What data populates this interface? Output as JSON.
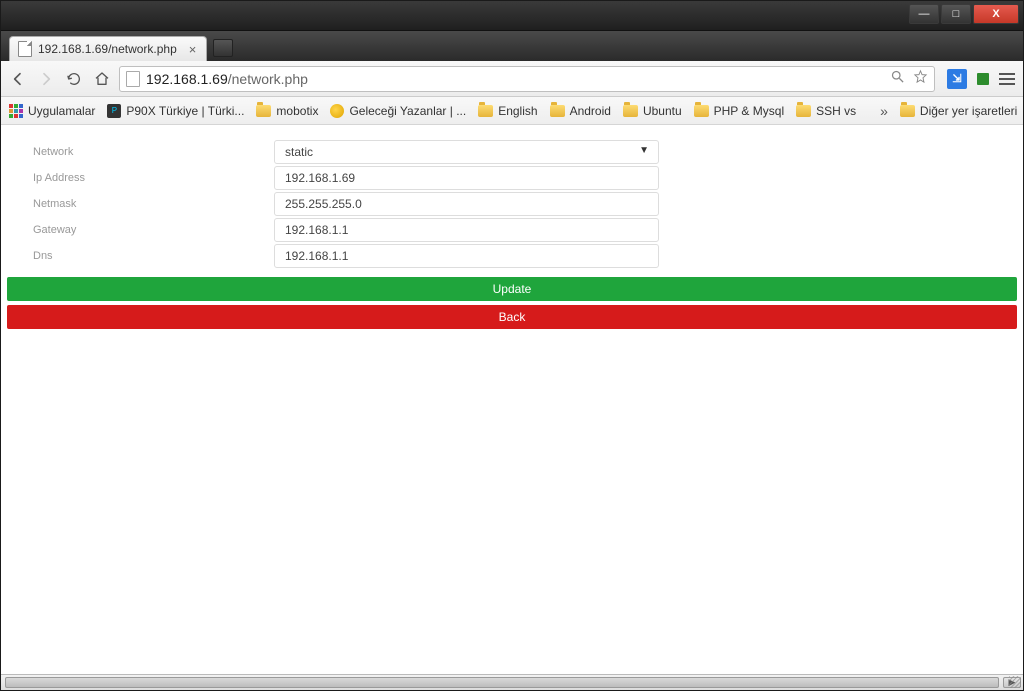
{
  "window": {
    "min": "—",
    "max": "□",
    "close": "X"
  },
  "tab": {
    "title": "192.168.1.69/network.php",
    "close": "×"
  },
  "navbar": {
    "url_host": "192.168.1.69",
    "url_path": "/network.php"
  },
  "bookmarks": {
    "apps": "Uygulamalar",
    "p90x": "P90X Türkiye | Türki...",
    "mobotix": "mobotix",
    "gelecegi": "Geleceği Yazanlar | ...",
    "english": "English",
    "android": "Android",
    "ubuntu": "Ubuntu",
    "php": "PHP & Mysql",
    "ssh": "SSH vs",
    "overflow": "»",
    "other": "Diğer yer işaretleri"
  },
  "form": {
    "network_label": "Network",
    "network_value": "static",
    "ip_label": "Ip Address",
    "ip_value": "192.168.1.69",
    "netmask_label": "Netmask",
    "netmask_value": "255.255.255.0",
    "gateway_label": "Gateway",
    "gateway_value": "192.168.1.1",
    "dns_label": "Dns",
    "dns_value": "192.168.1.1"
  },
  "buttons": {
    "update": "Update",
    "back": "Back"
  }
}
